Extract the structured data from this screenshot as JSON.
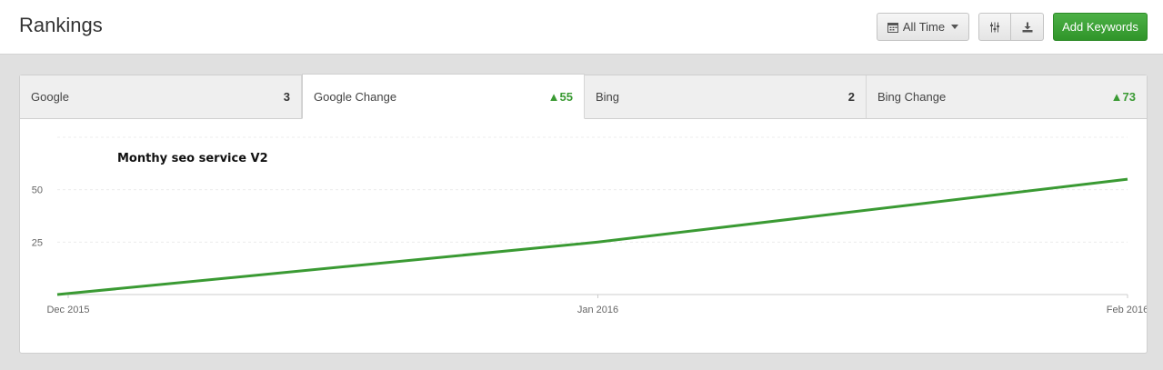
{
  "header": {
    "title": "Rankings",
    "range_label": "All Time",
    "add_keywords_label": "Add Keywords",
    "icons": [
      "calendar-icon",
      "caret-down-icon",
      "filter-sliders-icon",
      "download-icon"
    ]
  },
  "tabs": [
    {
      "label": "Google",
      "value": "3",
      "trend": "none",
      "active": false
    },
    {
      "label": "Google Change",
      "value": "▲55",
      "trend": "up",
      "active": true
    },
    {
      "label": "Bing",
      "value": "2",
      "trend": "none",
      "active": false
    },
    {
      "label": "Bing Change",
      "value": "▲73",
      "trend": "up",
      "active": false
    }
  ],
  "colors": {
    "accent_green": "#3a9a33",
    "line_green": "#3a9a33",
    "button_green": "#3a9f33"
  },
  "chart_data": {
    "type": "line",
    "title": "Monthy seo service V2",
    "x_labels": [
      "Dec 2015",
      "Jan 2016",
      "Feb 2016"
    ],
    "y_ticks": [
      25,
      50
    ],
    "ylim": [
      0,
      75
    ],
    "grid": true,
    "series": [
      {
        "x": [
          "Dec 2015",
          "Jan 2016",
          "Feb 2016"
        ],
        "values": [
          0,
          25,
          55
        ],
        "color": "#3a9a33"
      }
    ]
  }
}
